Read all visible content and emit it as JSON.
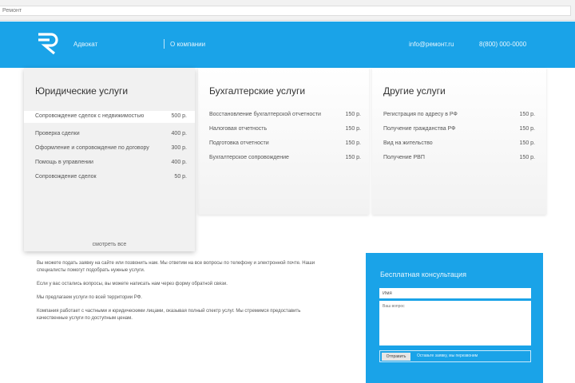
{
  "browser": {
    "url": "Ремонт"
  },
  "nav": {
    "logo_alt": "R",
    "left_links": [
      "Адвокат",
      "О компании"
    ],
    "right_links": [
      "info@ремонт.ru",
      "8(800) 000-0000"
    ]
  },
  "cards": [
    {
      "title": "Юридические услуги",
      "items": [
        {
          "name": "Сопровождение сделок с недвижимостью",
          "price": "500 р."
        },
        {
          "name": "Проверка сделки",
          "price": "400 р."
        },
        {
          "name": "Оформление и сопровождение по договору",
          "price": "300 р."
        },
        {
          "name": "Помощь в управлении",
          "price": "400 р."
        },
        {
          "name": "Сопровождение сделок",
          "price": "50 р."
        }
      ],
      "more": "смотреть все"
    },
    {
      "title": "Бухгалтерские услуги",
      "items": [
        {
          "name": "Восстановление бухгалтерской отчетности",
          "price": "150 р."
        },
        {
          "name": "Налоговая отчетность",
          "price": "150 р."
        },
        {
          "name": "Подготовка отчетности",
          "price": "150 р."
        },
        {
          "name": "Бухгалтерское сопровождение",
          "price": "150 р."
        }
      ]
    },
    {
      "title": "Другие услуги",
      "items": [
        {
          "name": "Регистрация по адресу в РФ",
          "price": "150 р."
        },
        {
          "name": "Получение гражданства РФ",
          "price": "150 р."
        },
        {
          "name": "Вид на жительство",
          "price": "150 р."
        },
        {
          "name": "Получение РВП",
          "price": "150 р."
        }
      ]
    }
  ],
  "info": {
    "p1": "Вы можете подать заявку на сайте или позвонить нам. Мы ответим на все вопросы по телефону и электронной почте. Наши специалисты помогут подобрать нужные услуги.",
    "p2": "Если у вас остались вопросы, вы можете написать нам через форму обратной связи.",
    "p3": "Мы предлагаем услуги по всей территории РФ.",
    "p4": "Компания работает с частными и юридическими лицами, оказывая полный спектр услуг. Мы стремимся предоставить качественные услуги по доступным ценам."
  },
  "consult": {
    "title": "Бесплатная консультация",
    "name_value": "Имя",
    "message_placeholder": "Ваш вопрос",
    "send_label": "Отправить",
    "note": "Оставьте заявку, мы перезвоним"
  }
}
